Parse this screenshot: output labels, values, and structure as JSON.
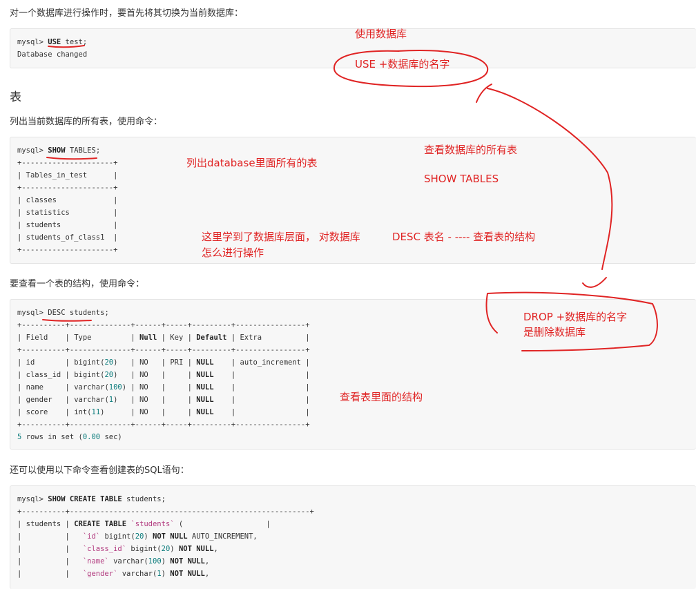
{
  "intro_text": "对一个数据库进行操作时，要首先将其切换为当前数据库：",
  "use_block": {
    "line1_prompt": "mysql> ",
    "line1_kw": "USE",
    "line1_rest": " test;",
    "line2": "Database changed"
  },
  "section_title": "表",
  "tables_text": "列出当前数据库的所有表，使用命令：",
  "show_block": {
    "prompt": "mysql> ",
    "kw": "SHOW",
    "rest": " TABLES;",
    "border": "+---------------------+",
    "header": "| Tables_in_test      |",
    "rows": [
      "| classes             |",
      "| statistics          |",
      "| students            |",
      "| students_of_class1  |"
    ]
  },
  "desc_text": "要查看一个表的结构，使用命令：",
  "desc_block": {
    "prompt": "mysql> ",
    "cmd": "DESC students;",
    "border": "+----------+--------------+------+-----+---------+----------------+",
    "columns": [
      "Field",
      "Type",
      "Null",
      "Key",
      "Default",
      "Extra"
    ],
    "rows": [
      [
        "id",
        "bigint(20)",
        "NO",
        "PRI",
        "NULL",
        "auto_increment"
      ],
      [
        "class_id",
        "bigint(20)",
        "NO",
        "",
        "NULL",
        ""
      ],
      [
        "name",
        "varchar(100)",
        "NO",
        "",
        "NULL",
        ""
      ],
      [
        "gender",
        "varchar(1)",
        "NO",
        "",
        "NULL",
        ""
      ],
      [
        "score",
        "int(11)",
        "NO",
        "",
        "NULL",
        ""
      ]
    ],
    "footer": "5 rows in set (0.00 sec)"
  },
  "create_text": "还可以使用以下命令查看创建表的SQL语句：",
  "create_block": {
    "prompt": "mysql> ",
    "kw": "SHOW CREATE TABLE",
    "rest": " students;",
    "border": "+----------+-------------------------------------------------------+",
    "table_name": "students",
    "create_kw": "CREATE TABLE",
    "create_rest": " `students` (",
    "lines": [
      "`id` bigint(20) NOT NULL AUTO_INCREMENT,",
      "`class_id` bigint(20) NOT NULL,",
      "`name` varchar(100) NOT NULL,",
      "`gender` varchar(1) NOT NULL,"
    ]
  },
  "annotations": {
    "use_db": "使用数据库",
    "use_syntax": "USE +数据库的名字",
    "list_tables": "列出database里面所有的表",
    "view_all_tables": "查看数据库的所有表",
    "show_tables": "SHOW TABLES",
    "learned_1": "这里学到了数据库层面， 对数据库",
    "learned_2": "怎么进行操作",
    "desc_hint": "DESC 表名 - ---- 查看表的结构",
    "drop_1": "DROP +数据库的名字",
    "drop_2": "是删除数据库",
    "view_structure": "查看表里面的结构"
  },
  "colors": {
    "ink": "#e02424",
    "code_bg": "#f7f7f7"
  }
}
